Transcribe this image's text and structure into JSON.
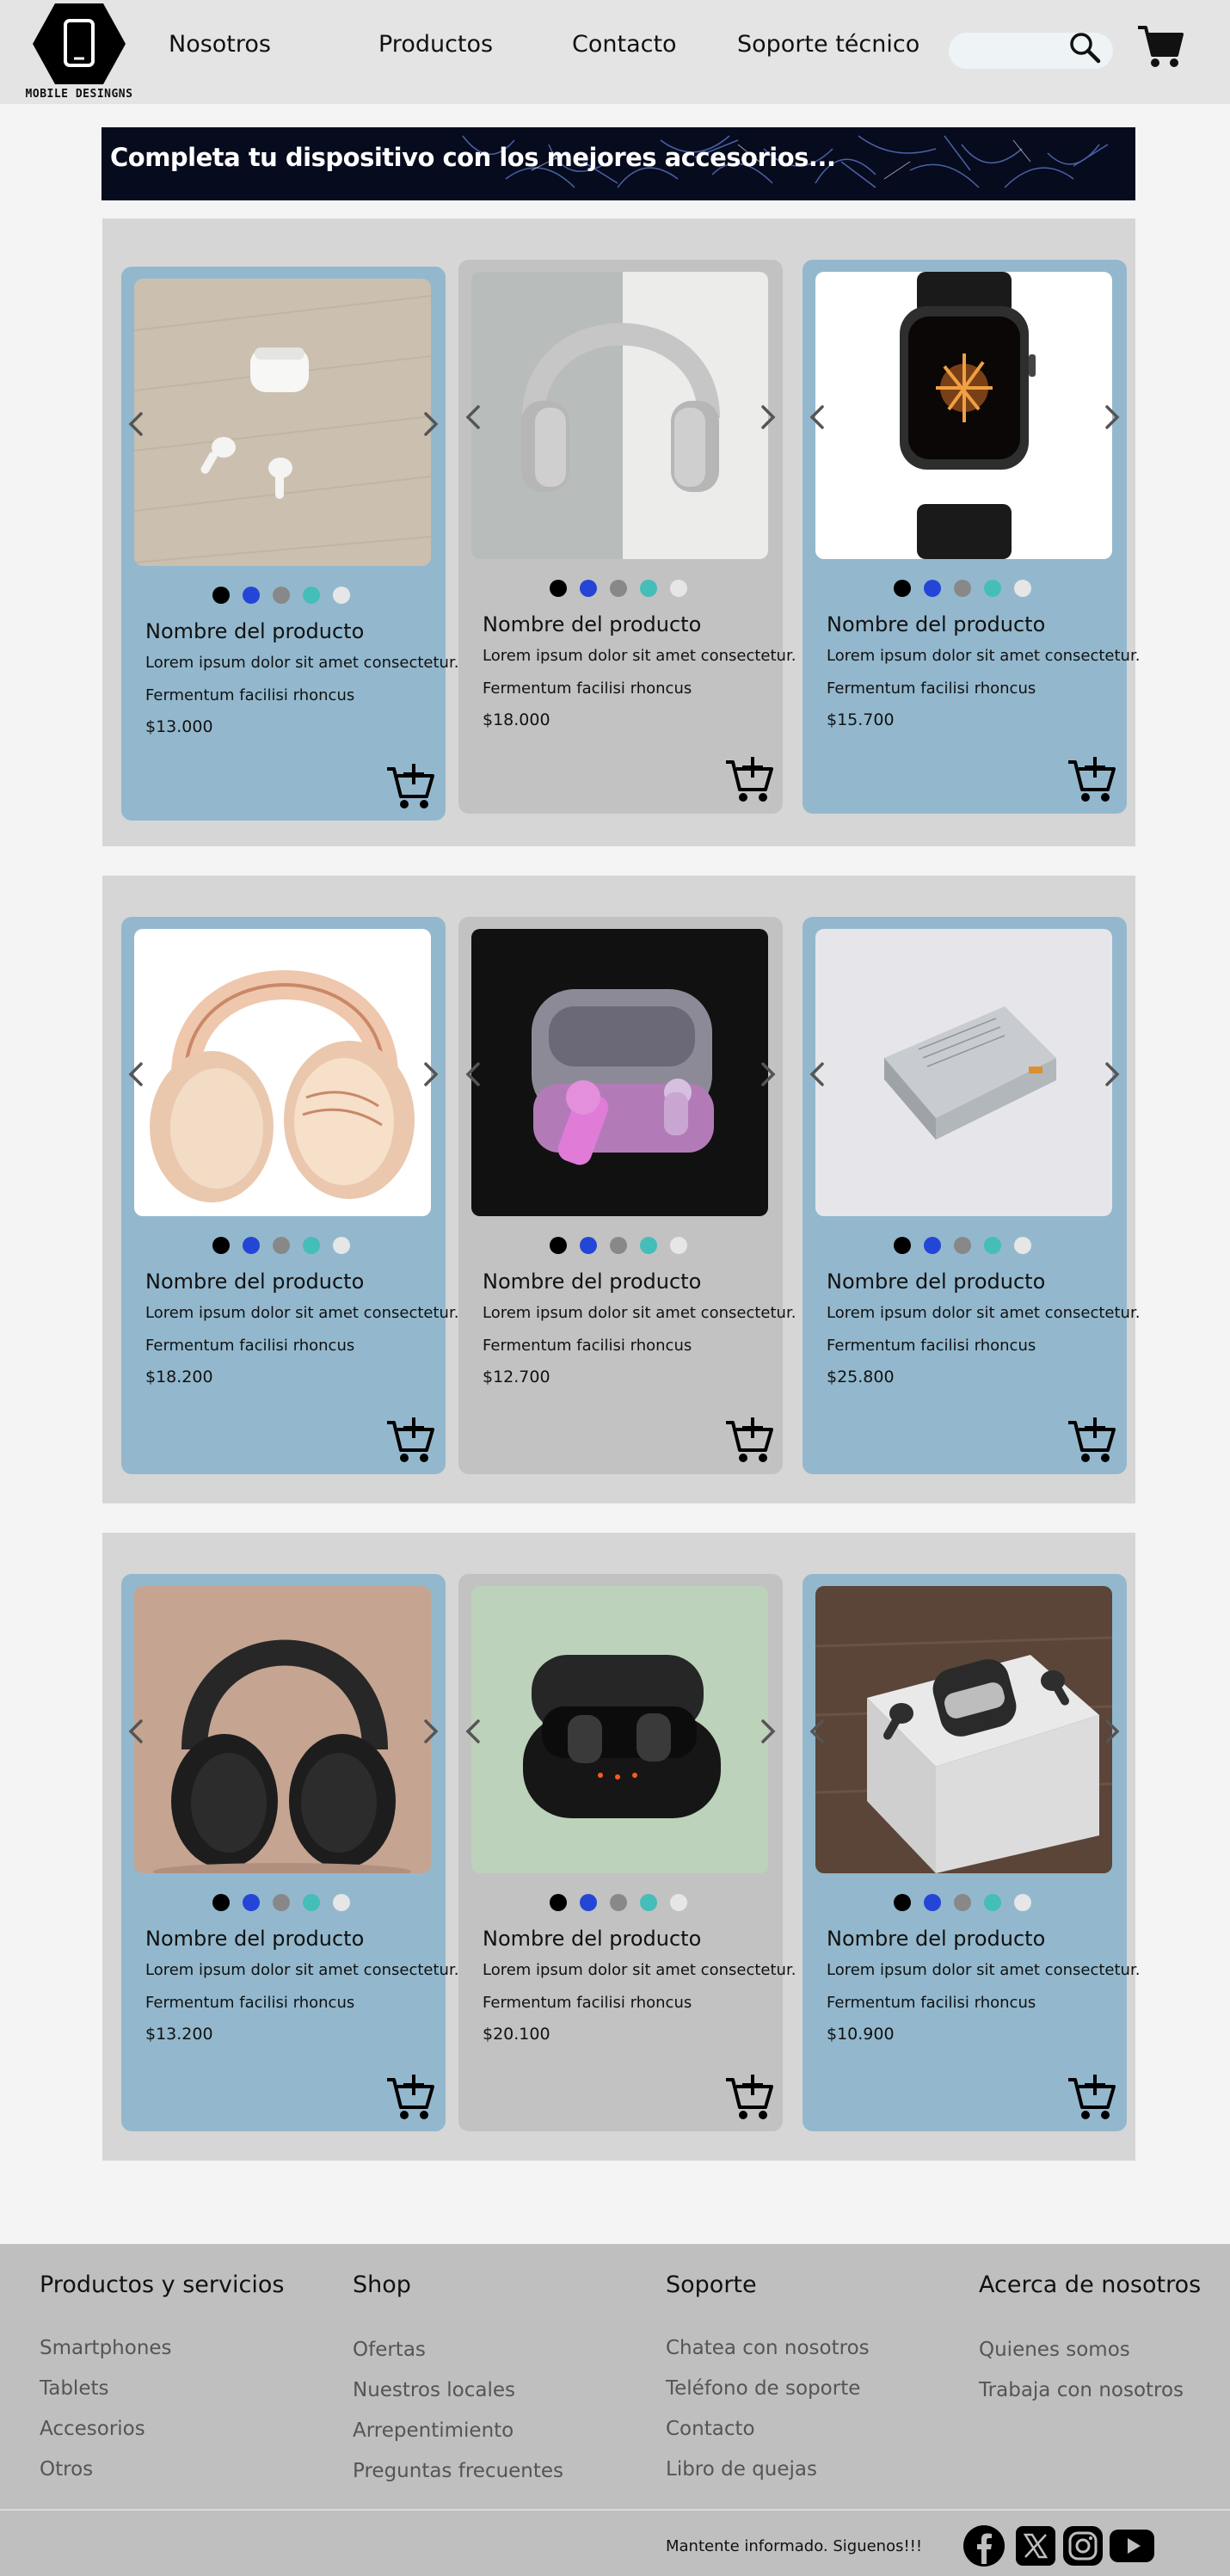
{
  "header": {
    "logo_text": "MOBILE DESINGNS",
    "nav": [
      "Nosotros",
      "Productos",
      "Contacto",
      "Soporte técnico"
    ],
    "search_placeholder": ""
  },
  "banner": {
    "text": "Completa tu dispositivo con los mejores accesorios..."
  },
  "colors": {
    "card_blue": "#93b8cd",
    "card_gray": "#c2c2c2",
    "section_bg": "#d6d6d6",
    "dot_colors": [
      "#000000",
      "#2446d6",
      "#888888",
      "#45bdb8",
      "#e6e6e6"
    ]
  },
  "products": [
    {
      "name": "Nombre del producto",
      "desc1": "Lorem ipsum dolor sit amet consectetur.",
      "desc2": "Fermentum facilisi rhoncus",
      "price": "$13.000",
      "image": "airpods-pro"
    },
    {
      "name": "Nombre del producto",
      "desc1": "Lorem ipsum dolor sit amet consectetur.",
      "desc2": "Fermentum facilisi rhoncus",
      "price": "$18.000",
      "image": "silver-headphones"
    },
    {
      "name": "Nombre del producto",
      "desc1": "Lorem ipsum dolor sit amet consectetur.",
      "desc2": "Fermentum facilisi rhoncus",
      "price": "$15.700",
      "image": "smartwatch"
    },
    {
      "name": "Nombre del producto",
      "desc1": "Lorem ipsum dolor sit amet consectetur.",
      "desc2": "Fermentum facilisi rhoncus",
      "price": "$18.200",
      "image": "rose-gold-headphones"
    },
    {
      "name": "Nombre del producto",
      "desc1": "Lorem ipsum dolor sit amet consectetur.",
      "desc2": "Fermentum facilisi rhoncus",
      "price": "$12.700",
      "image": "pink-earbuds"
    },
    {
      "name": "Nombre del producto",
      "desc1": "Lorem ipsum dolor sit amet consectetur.",
      "desc2": "Fermentum facilisi rhoncus",
      "price": "$25.800",
      "image": "power-bank"
    },
    {
      "name": "Nombre del producto",
      "desc1": "Lorem ipsum dolor sit amet consectetur.",
      "desc2": "Fermentum facilisi rhoncus",
      "price": "$13.200",
      "image": "black-headphones"
    },
    {
      "name": "Nombre del producto",
      "desc1": "Lorem ipsum dolor sit amet consectetur.",
      "desc2": "Fermentum facilisi rhoncus",
      "price": "$20.100",
      "image": "black-earbuds"
    },
    {
      "name": "Nombre del producto",
      "desc1": "Lorem ipsum dolor sit amet consectetur.",
      "desc2": "Fermentum facilisi rhoncus",
      "price": "$10.900",
      "image": "airpods-box"
    }
  ],
  "footer": {
    "columns": [
      {
        "title": "Productos y servicios",
        "links": [
          "Smartphones",
          "Tablets",
          "Accesorios",
          "Otros"
        ]
      },
      {
        "title": "Shop",
        "links": [
          "Ofertas",
          "Nuestros locales",
          "Arrepentimiento",
          "Preguntas frecuentes"
        ]
      },
      {
        "title": "Soporte",
        "links": [
          "Chatea con nosotros",
          "Teléfono de soporte",
          "Contacto",
          "Libro de quejas"
        ]
      },
      {
        "title": "Acerca de nosotros",
        "links": [
          "Quienes somos",
          "Trabaja con nosotros"
        ]
      }
    ],
    "follow_text": "Mantente informado. Siguenos!!!",
    "social": [
      "facebook-icon",
      "x-icon",
      "instagram-icon",
      "youtube-icon"
    ]
  }
}
